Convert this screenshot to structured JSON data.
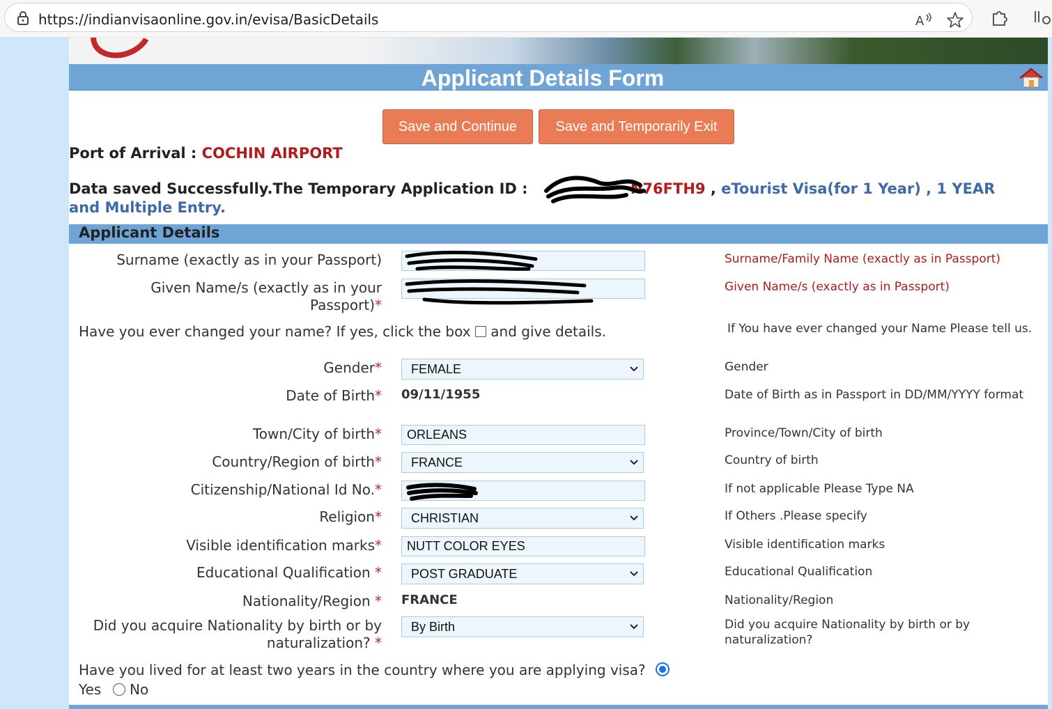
{
  "browser": {
    "url": "https://indianvisaonline.gov.in/evisa/BasicDetails"
  },
  "header": {
    "title": "Applicant Details Form"
  },
  "buttons": {
    "save_continue": "Save and Continue",
    "save_exit": "Save and Temporarily Exit"
  },
  "arrival": {
    "label": "Port of Arrival :",
    "value": "COCHIN AIRPORT"
  },
  "saved_message": {
    "prefix": "Data saved Successfully.The Temporary Application ID :",
    "app_id_visible": "N76FTH9",
    "separator": ",",
    "visa_type": "eTourist Visa(for 1 Year) , 1 YEAR",
    "visa_entry": "and Multiple Entry."
  },
  "section": {
    "title": "Applicant Details"
  },
  "form": {
    "surname": {
      "label": "Surname (exactly as in your Passport)",
      "hint": "Surname/Family Name (exactly as in Passport)"
    },
    "given": {
      "label_line1": "Given Name/s (exactly as in your",
      "label_line2": "Passport)",
      "hint": "Given Name/s (exactly as in Passport)"
    },
    "name_change": {
      "text_before": "Have you ever changed your name? If yes, click the box",
      "text_after": "and give details.",
      "hint": "If You have ever changed your Name Please tell us."
    },
    "gender": {
      "label": "Gender",
      "value": "FEMALE",
      "hint": "Gender"
    },
    "dob": {
      "label": "Date of Birth",
      "value": "09/11/1955",
      "hint": "Date of Birth as in Passport in DD/MM/YYYY format"
    },
    "town": {
      "label": "Town/City of birth",
      "value": "ORLEANS",
      "hint": "Province/Town/City of birth"
    },
    "country": {
      "label": "Country/Region of birth",
      "value": "FRANCE",
      "hint": "Country of birth"
    },
    "national_id": {
      "label": "Citizenship/National Id No.",
      "hint": "If not applicable Please Type NA"
    },
    "religion": {
      "label": "Religion",
      "value": "CHRISTIAN",
      "hint": "If Others .Please specify"
    },
    "marks": {
      "label": "Visible identification marks",
      "value": "NUTT COLOR EYES",
      "hint": "Visible identification marks"
    },
    "education": {
      "label": "Educational Qualification ",
      "value": "POST GRADUATE",
      "hint": "Educational Qualification"
    },
    "nationality": {
      "label": "Nationality/Region ",
      "value": "FRANCE",
      "hint": "Nationality/Region"
    },
    "acquire": {
      "label_line1": "Did you acquire Nationality by birth or by",
      "label_line2": "naturalization? ",
      "value": "By Birth",
      "hint": "Did you acquire Nationality by birth or by naturalization?"
    },
    "lived": {
      "question": "Have you lived for at least two years in the country where you are applying visa?",
      "yes": "Yes",
      "no": "No"
    }
  },
  "required_mark": "*"
}
